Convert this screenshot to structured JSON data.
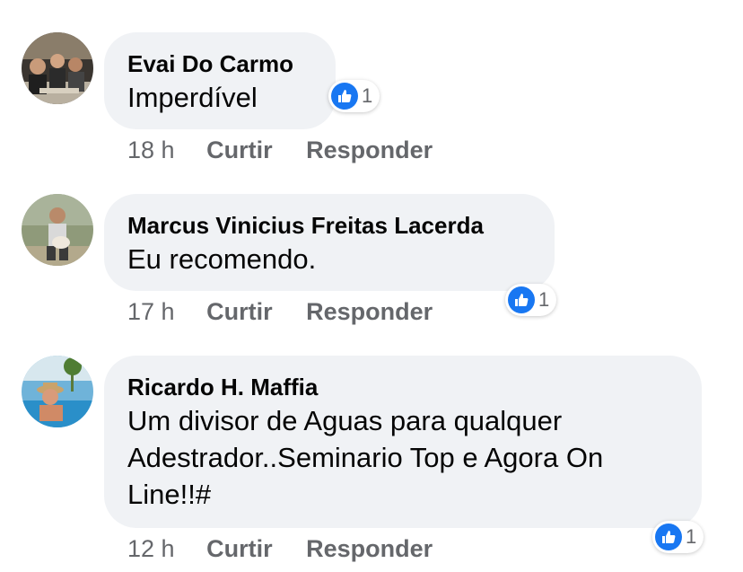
{
  "colors": {
    "bubble": "#f0f2f5",
    "meta_text": "#65676b",
    "like_blue": "#1877f2"
  },
  "comments": [
    {
      "author": "Evai Do Carmo",
      "text": "Imperdível",
      "time": "18 h",
      "like_label": "Curtir",
      "reply_label": "Responder",
      "reaction_icon": "like-icon",
      "reaction_count": "1"
    },
    {
      "author": "Marcus Vinicius Freitas Lacerda",
      "text": "Eu recomendo.",
      "time": "17 h",
      "like_label": "Curtir",
      "reply_label": "Responder",
      "reaction_icon": "like-icon",
      "reaction_count": "1"
    },
    {
      "author": "Ricardo H. Maffia",
      "text": "Um divisor de Aguas para qualquer Adestrador..Seminario Top e Agora On Line!!#",
      "time": "12 h",
      "like_label": "Curtir",
      "reply_label": "Responder",
      "reaction_icon": "like-icon",
      "reaction_count": "1"
    }
  ]
}
